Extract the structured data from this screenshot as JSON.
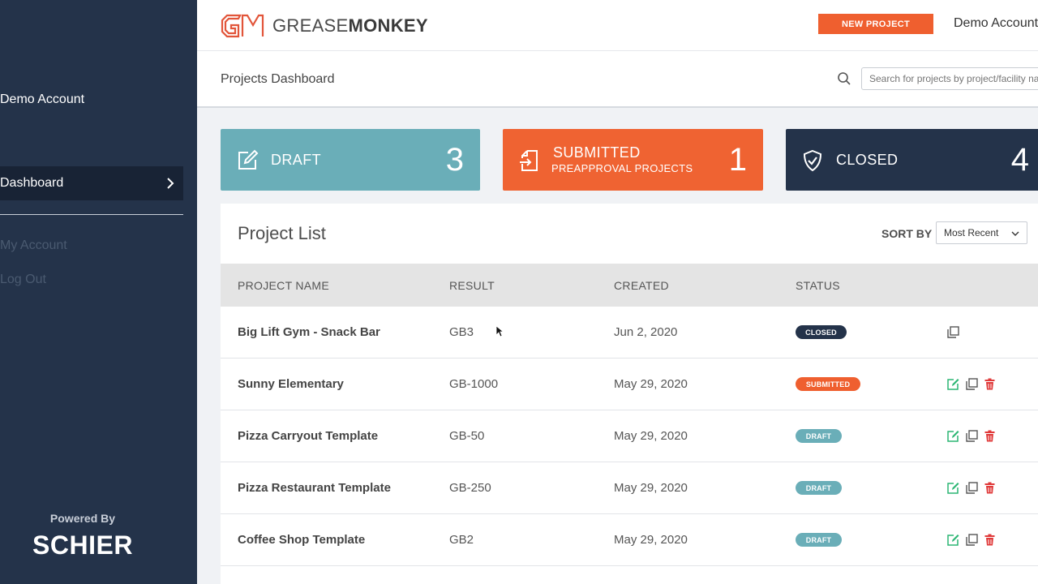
{
  "sidebar": {
    "account_name": "Demo Account",
    "active_item": "Dashboard",
    "links": [
      "My Account",
      "Log Out"
    ],
    "powered_by": "Powered By",
    "brand": "SCHIER"
  },
  "header": {
    "logo_prefix": "GREASE",
    "logo_suffix": "MONKEY",
    "new_project_label": "NEW PROJECT",
    "account_label": "Demo Account",
    "page_title": "Projects Dashboard",
    "search_placeholder": "Search for projects by project/facility name"
  },
  "cards": [
    {
      "label": "DRAFT",
      "sublabel": "",
      "count": "3",
      "icon": "edit-icon",
      "color": "#6aaeb8"
    },
    {
      "label": "SUBMITTED",
      "sublabel": "PREAPPROVAL PROJECTS",
      "count": "1",
      "icon": "submit-icon",
      "color": "#ef6332"
    },
    {
      "label": "CLOSED",
      "sublabel": "",
      "count": "4",
      "icon": "shield-check-icon",
      "color": "#24334a"
    }
  ],
  "project_list": {
    "title": "Project List",
    "sort_label": "SORT BY",
    "sort_value": "Most Recent",
    "columns": [
      "PROJECT NAME",
      "RESULT",
      "CREATED",
      "STATUS"
    ],
    "rows": [
      {
        "name": "Big Lift Gym - Snack Bar",
        "result": "GB3",
        "created": "Jun 2, 2020",
        "status": "CLOSED"
      },
      {
        "name": "Sunny Elementary",
        "result": "GB-1000",
        "created": "May 29, 2020",
        "status": "SUBMITTED"
      },
      {
        "name": "Pizza Carryout Template",
        "result": "GB-50",
        "created": "May 29, 2020",
        "status": "DRAFT"
      },
      {
        "name": "Pizza Restaurant Template",
        "result": "GB-250",
        "created": "May 29, 2020",
        "status": "DRAFT"
      },
      {
        "name": "Coffee Shop Template",
        "result": "GB2",
        "created": "May 29, 2020",
        "status": "DRAFT"
      }
    ]
  },
  "colors": {
    "sidebar": "#24334a",
    "accent_orange": "#ef5f2f",
    "draft_teal": "#6aaeb8",
    "edit_green": "#2bb673",
    "delete_red": "#e03a3a"
  }
}
